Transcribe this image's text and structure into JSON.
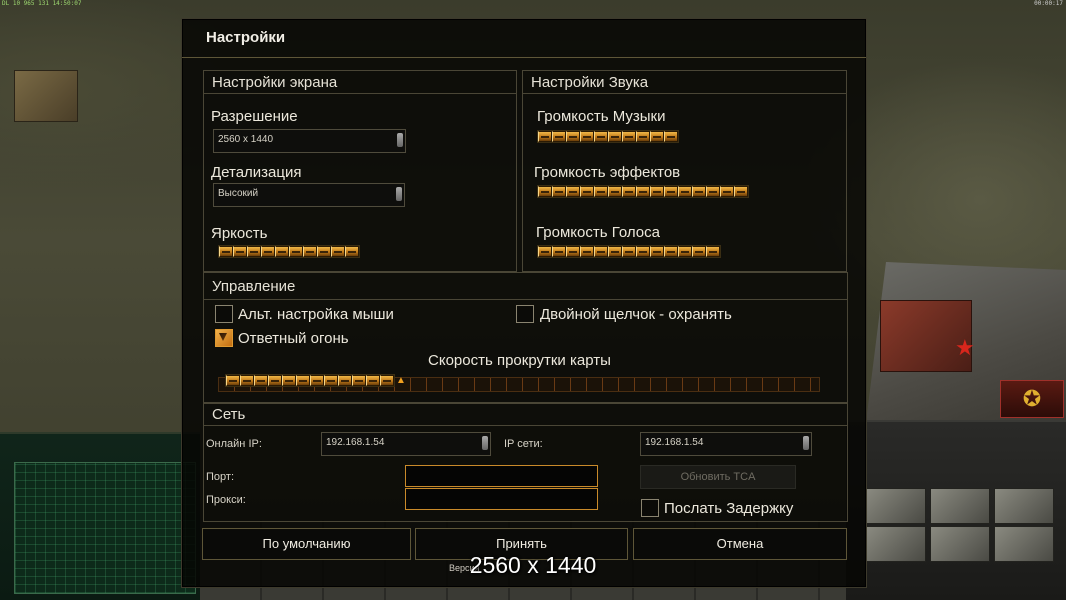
{
  "status_bar": {
    "left": "DL 10 965 131 14:50:07",
    "right": "00:00:17"
  },
  "dialog": {
    "title": "Настройки",
    "screen": {
      "header": "Настройки экрана",
      "resolution_label": "Разрешение",
      "resolution_value": "2560 x 1440",
      "detail_label": "Детализация",
      "detail_value": "Высокий",
      "brightness_label": "Яркость",
      "brightness_level": 10
    },
    "sound": {
      "header": "Настройки Звука",
      "music_label": "Громкость Музыки",
      "music_level": 10,
      "effects_label": "Громкость эффектов",
      "effects_level": 15,
      "voice_label": "Громкость Голоса",
      "voice_level": 13
    },
    "controls": {
      "header": "Управление",
      "alt_mouse_label": "Альт. настройка мыши",
      "alt_mouse_checked": false,
      "double_click_label": "Двойной щелчок - охранять",
      "double_click_checked": false,
      "return_fire_label": "Ответный огонь",
      "return_fire_checked": true,
      "scroll_speed_label": "Скорость прокрутки карты",
      "scroll_speed_level": 12
    },
    "network": {
      "header": "Сеть",
      "online_ip_label": "Онлайн IP:",
      "online_ip_value": "192.168.1.54",
      "network_ip_label": "IP сети:",
      "network_ip_value": "192.168.1.54",
      "port_label": "Порт:",
      "proxy_label": "Прокси:",
      "update_tca_label": "Обновить TCA",
      "send_delay_label": "Послать Задержку",
      "send_delay_checked": false
    },
    "buttons": {
      "default": "По умолчанию",
      "accept": "Принять",
      "cancel": "Отмена"
    }
  },
  "overlay_resolution": "2560 x 1440",
  "version_text": "Версия"
}
